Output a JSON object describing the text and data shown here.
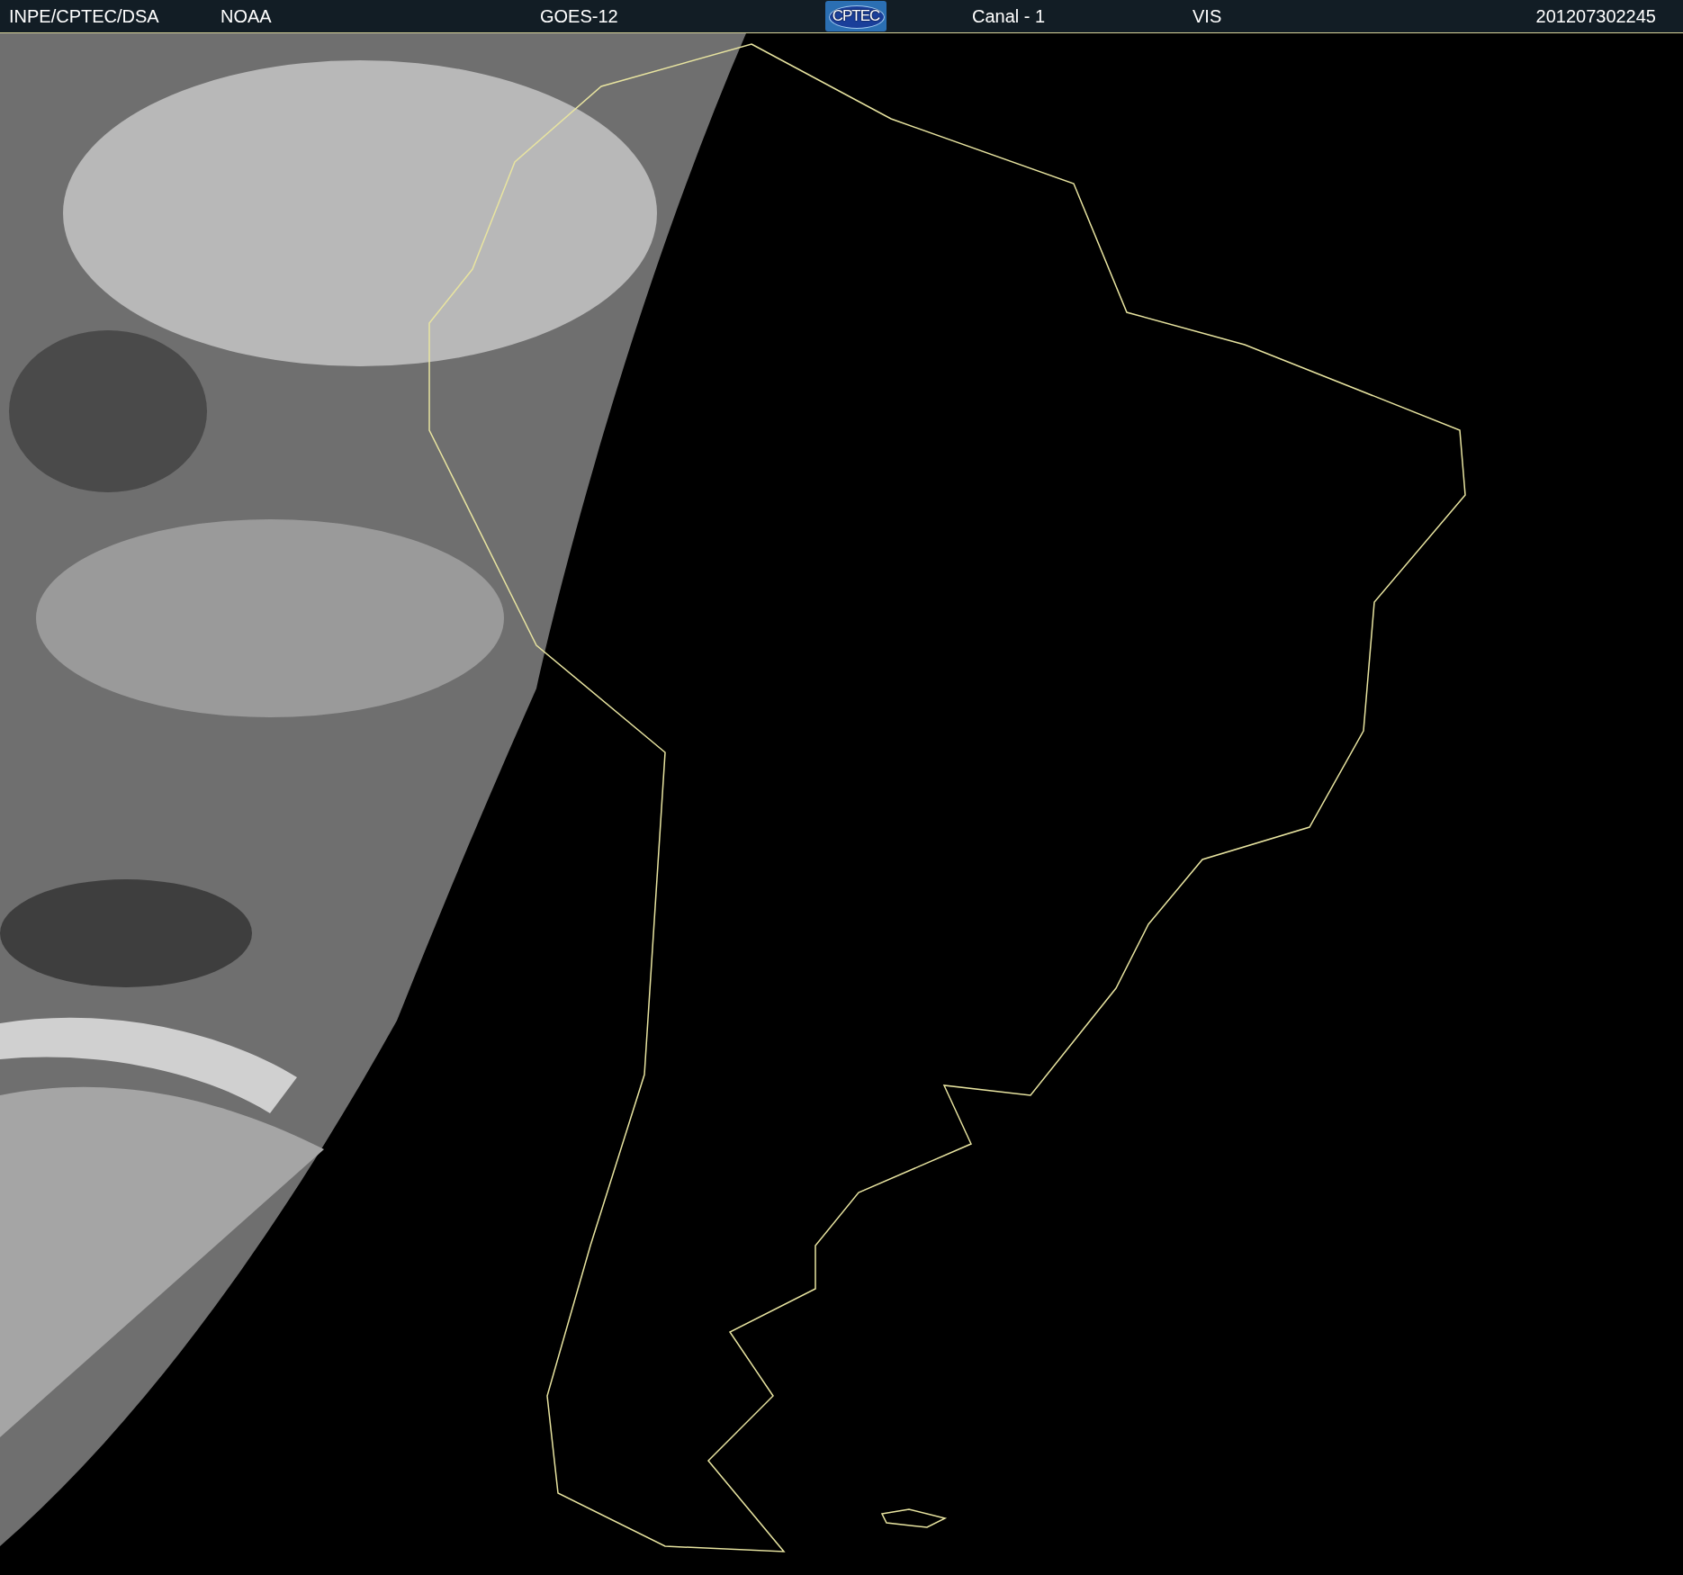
{
  "header": {
    "source": "INPE/CPTEC/DSA",
    "agency": "NOAA",
    "satellite": "GOES-12",
    "logo": "CPTEC",
    "channel": "Canal - 1",
    "band": "VIS",
    "timestamp": "201207302245"
  }
}
